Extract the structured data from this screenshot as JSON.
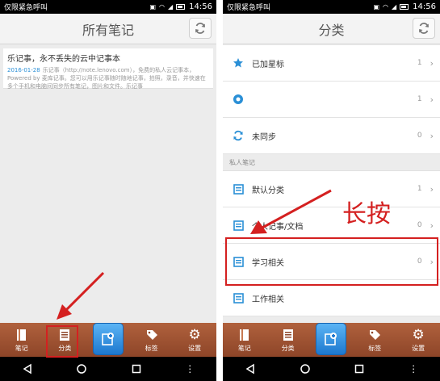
{
  "left": {
    "status": {
      "carrier": "仅限紧急呼叫",
      "time": "14:56"
    },
    "title": "所有笔记",
    "note": {
      "title": "乐记事，永不丢失的云中记事本",
      "date": "2016-01-28",
      "preview": "乐记事（http://note.lenovo.com），免费的私人云记事本，Powered by 麦库记事。您可以用乐记事随时随地记事，拍照，录音，并快速在多个手机和电脑间同步所有笔记，图片和文件。乐记事"
    },
    "tabs": [
      "笔记",
      "分类",
      "",
      "标签",
      "设置"
    ]
  },
  "right": {
    "status": {
      "carrier": "仅限紧急呼叫",
      "time": "14:56"
    },
    "title": "分类",
    "top_rows": [
      {
        "label": "已加星标",
        "count": "1",
        "icon": "star-icon",
        "color": "#2a8fd6"
      },
      {
        "label": "",
        "count": "1",
        "icon": "shared-icon",
        "color": "#2a8fd6"
      },
      {
        "label": "未同步",
        "count": "0",
        "icon": "sync-icon",
        "color": "#2a8fd6"
      }
    ],
    "section": "私人笔记",
    "private_rows": [
      {
        "label": "默认分类",
        "count": "1"
      },
      {
        "label": "个人记事/文档",
        "count": "0"
      },
      {
        "label": "学习相关",
        "count": "0"
      },
      {
        "label": "工作相关",
        "count": ""
      }
    ],
    "annotation": "长按",
    "tabs": [
      "笔记",
      "分类",
      "",
      "标签",
      "设置"
    ]
  },
  "colors": {
    "accent": "#2a8fd6",
    "tab_bar": "#9e5233",
    "highlight": "#d42020"
  }
}
